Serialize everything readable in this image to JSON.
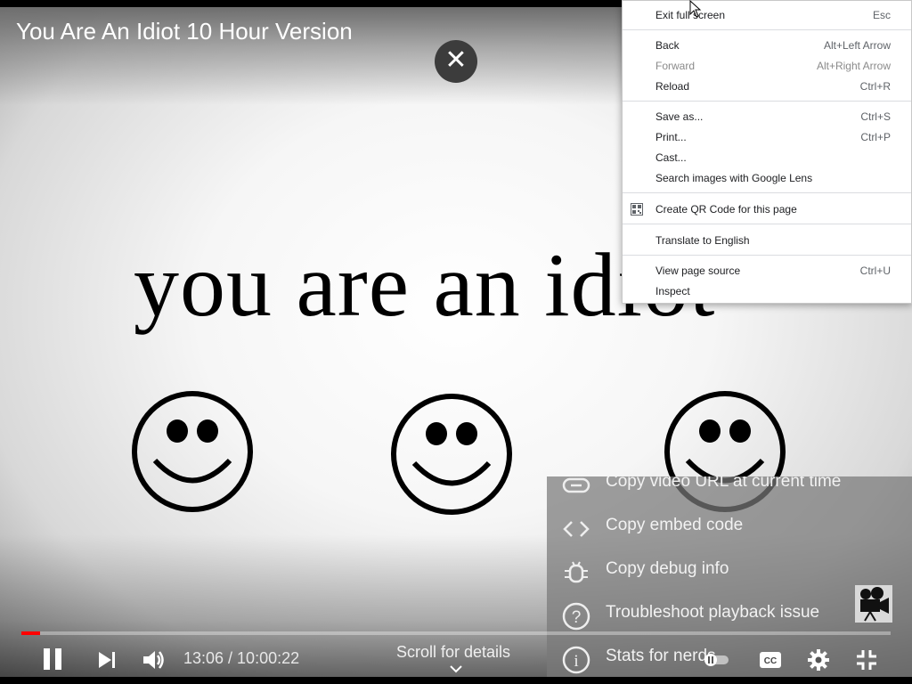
{
  "video": {
    "title": "You Are An Idiot 10 Hour Version",
    "frame_text": "you are an idiot",
    "time_display": "13:06 / 10:00:22",
    "progress_fraction": 0.0218,
    "buffered_fraction": 0.0218,
    "scroll_hint": "Scroll for details"
  },
  "context_menu": {
    "items": [
      {
        "label": "Exit full screen",
        "shortcut": "Esc"
      },
      {
        "label": "Back",
        "shortcut": "Alt+Left Arrow"
      },
      {
        "label": "Forward",
        "shortcut": "Alt+Right Arrow"
      },
      {
        "label": "Reload",
        "shortcut": "Ctrl+R"
      },
      {
        "label": "Save as...",
        "shortcut": "Ctrl+S"
      },
      {
        "label": "Print...",
        "shortcut": "Ctrl+P"
      },
      {
        "label": "Cast...",
        "shortcut": ""
      },
      {
        "label": "Search images with Google Lens",
        "shortcut": ""
      },
      {
        "label": "Create QR Code for this page",
        "shortcut": ""
      },
      {
        "label": "Translate to English",
        "shortcut": ""
      },
      {
        "label": "View page source",
        "shortcut": "Ctrl+U"
      },
      {
        "label": "Inspect",
        "shortcut": ""
      }
    ]
  },
  "player_menu": {
    "items": [
      {
        "label": "Copy video URL at current time",
        "icon": "link-icon"
      },
      {
        "label": "Copy embed code",
        "icon": "code-icon"
      },
      {
        "label": "Copy debug info",
        "icon": "bug-icon"
      },
      {
        "label": "Troubleshoot playback issue",
        "icon": "help-icon"
      },
      {
        "label": "Stats for nerds",
        "icon": "info-icon"
      }
    ]
  },
  "colors": {
    "progress": "#ff0000",
    "menu_bg": "#ffffff",
    "menu_text": "#202124",
    "menu_disabled": "#8a8a8a",
    "panel_bg": "#787878"
  }
}
